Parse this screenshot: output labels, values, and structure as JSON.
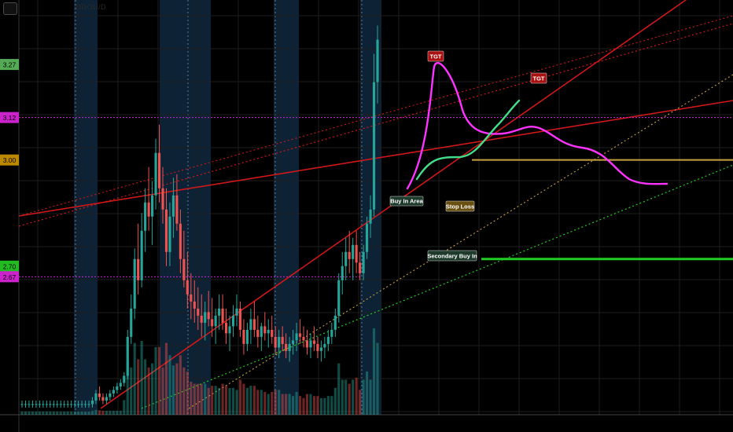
{
  "header": {
    "symbol": "ODOU/D"
  },
  "colors": {
    "background": "#000000",
    "grid": "#1e1e1e",
    "highlight": "#0e2236",
    "candle_up": "#26a69a",
    "candle_down": "#ef5350",
    "trend_red": "#d01818",
    "orange": "#c8a040",
    "green": "#22cc22",
    "magenta": "#e040e0",
    "projection_magenta": "#ff33ff",
    "projection_green": "#44dd88"
  },
  "chart_data": {
    "type": "candlestick",
    "title": "",
    "xlabel": "",
    "ylabel": "",
    "ylim": [
      2.28,
      3.43
    ],
    "y_axis_markers": [
      {
        "label": "3.27",
        "value": 3.27,
        "color": "#55aa55"
      },
      {
        "label": "3.12",
        "value": 3.12,
        "color": "#cc22cc"
      },
      {
        "label": "3.00",
        "value": 3.0,
        "color": "#bb8800"
      },
      {
        "label": "2.70",
        "value": 2.7,
        "color": "#22bb22"
      },
      {
        "label": "2.67",
        "value": 2.67,
        "color": "#cc22cc"
      }
    ],
    "horizontal_levels": [
      {
        "name": "buy-in-level",
        "value": 3.12,
        "color": "#cc22cc",
        "style": "dotted"
      },
      {
        "name": "stop-loss-level",
        "value": 3.0,
        "color": "#c8a040",
        "style": "solid"
      },
      {
        "name": "secondary-buy-level",
        "value": 2.72,
        "color": "#22cc22",
        "style": "solid"
      },
      {
        "name": "lower-magenta-level",
        "value": 2.67,
        "color": "#cc22cc",
        "style": "dotted"
      }
    ],
    "annotations": [
      {
        "name": "tgt-label-1",
        "text": "TGT",
        "bg": "#aa1111",
        "color": "#ffffff"
      },
      {
        "name": "tgt-label-2",
        "text": "TGT",
        "bg": "#aa1111",
        "color": "#ffffff"
      },
      {
        "name": "buy-in-area-label",
        "text": "Buy In Area",
        "bg": "#1d3a2a",
        "color": "#ffffff"
      },
      {
        "name": "stop-loss-label",
        "text": "Stop Loss",
        "bg": "#6a5010",
        "color": "#ffffff"
      },
      {
        "name": "secondary-buy-label",
        "text": "Secondary Buy In",
        "bg": "#1d3a2a",
        "color": "#ffffff"
      }
    ],
    "candles": [
      [
        2.31,
        2.32,
        2.3,
        2.31
      ],
      [
        2.31,
        2.32,
        2.3,
        2.31
      ],
      [
        2.31,
        2.32,
        2.3,
        2.31
      ],
      [
        2.31,
        2.32,
        2.3,
        2.31
      ],
      [
        2.31,
        2.32,
        2.3,
        2.31
      ],
      [
        2.31,
        2.32,
        2.3,
        2.31
      ],
      [
        2.31,
        2.32,
        2.3,
        2.31
      ],
      [
        2.31,
        2.32,
        2.3,
        2.31
      ],
      [
        2.31,
        2.32,
        2.3,
        2.31
      ],
      [
        2.31,
        2.32,
        2.3,
        2.31
      ],
      [
        2.31,
        2.32,
        2.3,
        2.31
      ],
      [
        2.31,
        2.32,
        2.3,
        2.31
      ],
      [
        2.31,
        2.32,
        2.3,
        2.31
      ],
      [
        2.31,
        2.32,
        2.3,
        2.31
      ],
      [
        2.31,
        2.32,
        2.3,
        2.31
      ],
      [
        2.31,
        2.32,
        2.3,
        2.31
      ],
      [
        2.31,
        2.32,
        2.3,
        2.31
      ],
      [
        2.31,
        2.32,
        2.3,
        2.31
      ],
      [
        2.31,
        2.32,
        2.3,
        2.31
      ],
      [
        2.31,
        2.32,
        2.3,
        2.31
      ],
      [
        2.31,
        2.33,
        2.3,
        2.32
      ],
      [
        2.32,
        2.35,
        2.31,
        2.34
      ],
      [
        2.34,
        2.36,
        2.32,
        2.33
      ],
      [
        2.33,
        2.34,
        2.31,
        2.32
      ],
      [
        2.32,
        2.34,
        2.31,
        2.33
      ],
      [
        2.33,
        2.35,
        2.32,
        2.34
      ],
      [
        2.34,
        2.36,
        2.33,
        2.35
      ],
      [
        2.35,
        2.37,
        2.34,
        2.36
      ],
      [
        2.36,
        2.38,
        2.35,
        2.37
      ],
      [
        2.37,
        2.4,
        2.36,
        2.39
      ],
      [
        2.39,
        2.52,
        2.38,
        2.5
      ],
      [
        2.5,
        2.62,
        2.48,
        2.58
      ],
      [
        2.58,
        2.75,
        2.55,
        2.72
      ],
      [
        2.72,
        2.82,
        2.62,
        2.66
      ],
      [
        2.66,
        2.85,
        2.64,
        2.8
      ],
      [
        2.8,
        2.92,
        2.74,
        2.88
      ],
      [
        2.88,
        2.98,
        2.8,
        2.84
      ],
      [
        2.84,
        2.94,
        2.76,
        2.9
      ],
      [
        2.9,
        3.06,
        2.86,
        3.02
      ],
      [
        3.02,
        3.1,
        2.88,
        2.92
      ],
      [
        2.92,
        2.98,
        2.82,
        2.86
      ],
      [
        2.86,
        2.92,
        2.7,
        2.74
      ],
      [
        2.74,
        2.88,
        2.7,
        2.84
      ],
      [
        2.84,
        2.95,
        2.78,
        2.9
      ],
      [
        2.9,
        2.96,
        2.8,
        2.82
      ],
      [
        2.82,
        2.86,
        2.68,
        2.72
      ],
      [
        2.72,
        2.8,
        2.64,
        2.66
      ],
      [
        2.66,
        2.74,
        2.58,
        2.62
      ],
      [
        2.62,
        2.68,
        2.55,
        2.6
      ],
      [
        2.6,
        2.66,
        2.54,
        2.58
      ],
      [
        2.58,
        2.64,
        2.52,
        2.56
      ],
      [
        2.56,
        2.62,
        2.5,
        2.54
      ],
      [
        2.54,
        2.6,
        2.49,
        2.57
      ],
      [
        2.57,
        2.63,
        2.53,
        2.55
      ],
      [
        2.55,
        2.61,
        2.5,
        2.53
      ],
      [
        2.53,
        2.58,
        2.48,
        2.56
      ],
      [
        2.56,
        2.62,
        2.52,
        2.58
      ],
      [
        2.58,
        2.62,
        2.52,
        2.54
      ],
      [
        2.54,
        2.58,
        2.48,
        2.51
      ],
      [
        2.51,
        2.56,
        2.46,
        2.53
      ],
      [
        2.53,
        2.59,
        2.5,
        2.56
      ],
      [
        2.56,
        2.62,
        2.53,
        2.58
      ],
      [
        2.58,
        2.6,
        2.5,
        2.52
      ],
      [
        2.52,
        2.55,
        2.45,
        2.48
      ],
      [
        2.48,
        2.54,
        2.46,
        2.52
      ],
      [
        2.52,
        2.58,
        2.48,
        2.55
      ],
      [
        2.55,
        2.6,
        2.5,
        2.52
      ],
      [
        2.52,
        2.56,
        2.47,
        2.5
      ],
      [
        2.5,
        2.54,
        2.46,
        2.53
      ],
      [
        2.53,
        2.57,
        2.49,
        2.51
      ],
      [
        2.51,
        2.55,
        2.47,
        2.52
      ],
      [
        2.52,
        2.56,
        2.48,
        2.5
      ],
      [
        2.5,
        2.53,
        2.45,
        2.47
      ],
      [
        2.47,
        2.52,
        2.44,
        2.5
      ],
      [
        2.5,
        2.53,
        2.46,
        2.48
      ],
      [
        2.48,
        2.51,
        2.44,
        2.46
      ],
      [
        2.46,
        2.5,
        2.43,
        2.48
      ],
      [
        2.48,
        2.52,
        2.45,
        2.49
      ],
      [
        2.49,
        2.54,
        2.46,
        2.51
      ],
      [
        2.51,
        2.55,
        2.48,
        2.5
      ],
      [
        2.5,
        2.53,
        2.47,
        2.49
      ],
      [
        2.49,
        2.52,
        2.45,
        2.47
      ],
      [
        2.47,
        2.51,
        2.44,
        2.49
      ],
      [
        2.49,
        2.53,
        2.46,
        2.48
      ],
      [
        2.48,
        2.5,
        2.44,
        2.46
      ],
      [
        2.46,
        2.49,
        2.43,
        2.47
      ],
      [
        2.47,
        2.5,
        2.44,
        2.48
      ],
      [
        2.48,
        2.52,
        2.46,
        2.5
      ],
      [
        2.5,
        2.54,
        2.48,
        2.52
      ],
      [
        2.52,
        2.58,
        2.5,
        2.56
      ],
      [
        2.56,
        2.68,
        2.54,
        2.66
      ],
      [
        2.66,
        2.74,
        2.62,
        2.7
      ],
      [
        2.7,
        2.78,
        2.66,
        2.74
      ],
      [
        2.74,
        2.8,
        2.68,
        2.72
      ],
      [
        2.72,
        2.78,
        2.66,
        2.76
      ],
      [
        2.76,
        2.8,
        2.68,
        2.71
      ],
      [
        2.71,
        2.74,
        2.66,
        2.68
      ],
      [
        2.68,
        2.76,
        2.66,
        2.74
      ],
      [
        2.74,
        2.84,
        2.72,
        2.82
      ],
      [
        2.82,
        2.9,
        2.78,
        2.86
      ],
      [
        2.86,
        3.3,
        2.84,
        3.22
      ],
      [
        3.22,
        3.38,
        3.16,
        3.34
      ]
    ],
    "projection": "two hand-drawn price paths toward TGT targets"
  }
}
